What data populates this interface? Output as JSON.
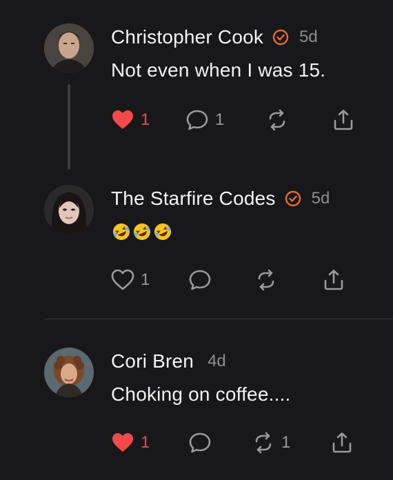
{
  "posts": [
    {
      "author": "Christopher Cook",
      "verified": true,
      "time": "5d",
      "text": "Not even when I was 15.",
      "liked": true,
      "like_count": "1",
      "reply_count": "1",
      "repost_count": ""
    },
    {
      "author": "The Starfire Codes",
      "verified": true,
      "time": "5d",
      "text_emoji": [
        "rolling-on-floor-laughing",
        "rolling-on-floor-laughing",
        "rolling-on-floor-laughing"
      ],
      "liked": false,
      "like_count": "1",
      "reply_count": "",
      "repost_count": ""
    },
    {
      "author": "Cori Bren",
      "verified": false,
      "time": "4d",
      "text": "Choking on coffee....",
      "liked": true,
      "like_count": "1",
      "reply_count": "",
      "repost_count": "1"
    }
  ],
  "colors": {
    "background": "#18181a",
    "like_red": "#f04a4a",
    "verified_orange": "#f06a2a",
    "muted": "#9a9a9f"
  },
  "icons": [
    "heart-icon",
    "comment-icon",
    "repost-icon",
    "share-icon",
    "verified-badge-icon"
  ]
}
